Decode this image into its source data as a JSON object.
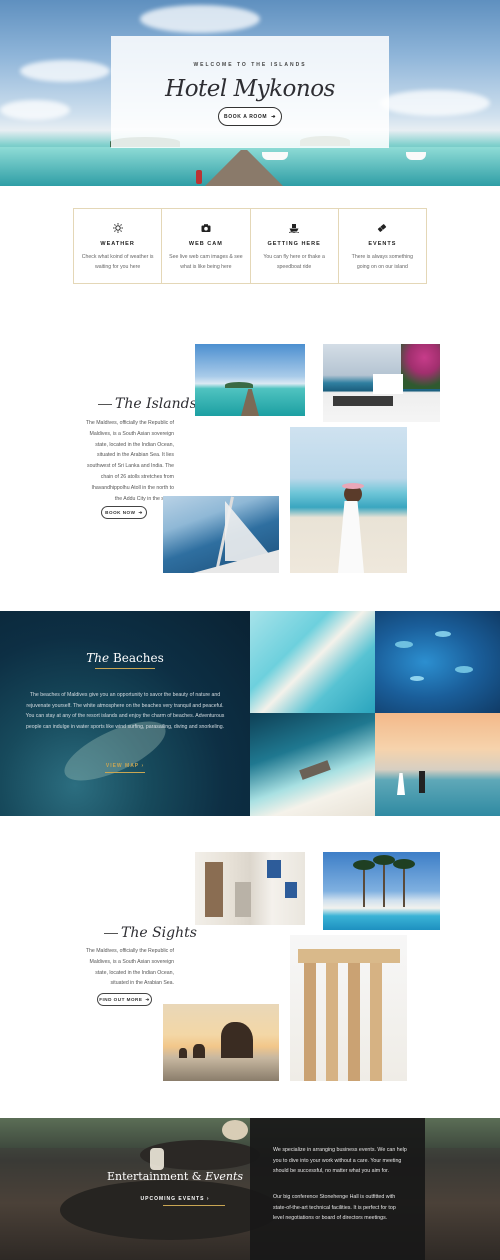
{
  "hero": {
    "eyebrow": "WELCOME TO THE ISLANDS",
    "title": "Hotel Mykonos",
    "button_label": "BOOK A ROOM",
    "button_icon": "arrow-right-icon"
  },
  "features": [
    {
      "icon": "sun-icon",
      "title": "WEATHER",
      "text": "Check what koind of weather is waiting for you here"
    },
    {
      "icon": "camera-icon",
      "title": "WEB CAM",
      "text": "See live web cam images & see what is like being here"
    },
    {
      "icon": "boat-icon",
      "title": "GETTING HERE",
      "text": "You can fly here or thake a speedboat ride"
    },
    {
      "icon": "ticket-icon",
      "title": "EVENTS",
      "text": "There is always something going on on our island"
    }
  ],
  "islands": {
    "title": "The Islands",
    "body_lines": [
      "The Maldives, officially the Republic of",
      "Maldives, is a South Asian sovereign",
      "state, located in the Indian Ocean,",
      "situated in the Arabian Sea. It lies",
      "southwest of Sri Lanka and India. The",
      "chain of 26 atolls stretches from",
      "Ihavandhippolhu Atoll in the north to",
      "the Addu City in the south"
    ],
    "button_label": "BOOK NOW"
  },
  "beaches": {
    "title_italic": "The",
    "title_rest": "Beaches",
    "body": "The beaches of Maldives give you an opportunity to savor the beauty of nature and rejuvenate yourself. The white atmosphere on the beaches very tranquil and peaceful. You can stay at any of the resort islands and enjoy the charm of beaches. Adventurous people can indulge in water sports like wind surfing, parasailing, diving and snorkeling.",
    "link_label": "VIEW MAP"
  },
  "sights": {
    "title": "The Sights",
    "body_lines": [
      "The Maldives, officially the Republic of",
      "Maldives, is a South Asian sovereign",
      "state, located in the Indian Ocean,",
      "situated in the Arabian Sea."
    ],
    "button_label": "FIND OUT MORE"
  },
  "entertainment": {
    "title_plain": "Entertainment &",
    "title_italic": "Events",
    "link_label": "UPCOMING EVENTS",
    "paragraph_1": "We specialize in arranging business events. We can help you to dive into your work without a care. Your meeting should be successful, no matter what you aim for.",
    "paragraph_2": "Our big conference Stonehenge Hall is outfitted with state-of-the-art technical facilities. It is perfect for top level negotiations or board of directors meetings."
  },
  "colors": {
    "accent_gold": "#c9a653",
    "feature_border": "#e4d7b7",
    "dark_navy": "#0d2f44",
    "text_dark": "#2e2e33"
  }
}
